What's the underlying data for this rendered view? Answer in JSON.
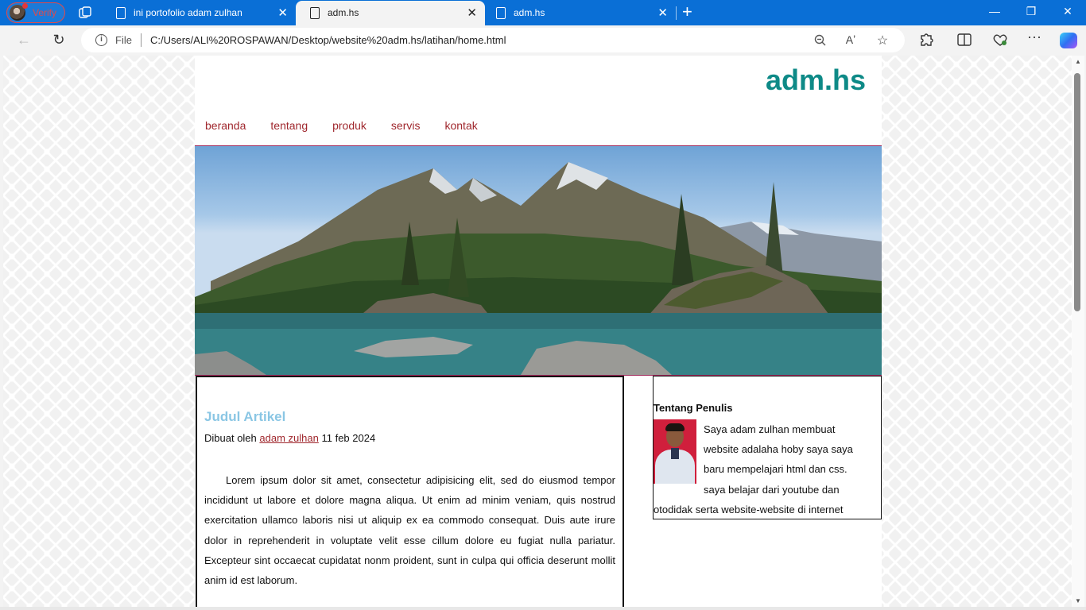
{
  "browser": {
    "profile_label": "Verify",
    "tabs": [
      {
        "title": "ini portofolio adam zulhan",
        "close": "✕"
      },
      {
        "title": "adm.hs",
        "close": "✕"
      },
      {
        "title": "adm.hs",
        "close": "✕"
      }
    ],
    "new_tab": "+",
    "window": {
      "minimize": "—",
      "restore": "❐",
      "close": "✕"
    },
    "address": {
      "scheme_label": "File",
      "url": "C:/Users/ALI%20ROSPAWAN/Desktop/website%20adm.hs/latihan/home.html"
    },
    "icons": {
      "back": "back-icon",
      "refresh": "refresh-icon",
      "zoom": "zoom-icon",
      "read_aloud": "read-aloud-icon",
      "favorite": "star-icon",
      "extensions": "puzzle-icon",
      "split": "split-screen-icon",
      "health": "browser-essentials-icon",
      "menu": "more-icon",
      "copilot": "copilot-icon"
    }
  },
  "page": {
    "site_title": "adm.hs",
    "menu": [
      "beranda",
      "tentang",
      "produk",
      "servis",
      "kontak"
    ],
    "article": {
      "title": "Judul Artikel",
      "meta_prefix": "Dibuat oleh",
      "author": "adam zulhan",
      "date": "11 feb 2024",
      "body": "Lorem ipsum dolor sit amet, consectetur adipisicing elit, sed do eiusmod tempor incididunt ut labore et dolore magna aliqua. Ut enim ad minim veniam, quis nostrud exercitation ullamco laboris nisi ut aliquip ex ea commodo consequat. Duis aute irure dolor in reprehenderit in voluptate velit esse cillum dolore eu fugiat nulla pariatur. Excepteur sint occaecat cupidatat nonm proident, sunt in culpa qui officia deserunt mollit anim id est laborum."
    },
    "aside": {
      "title": "Tentang Penulis",
      "text": "Saya adam zulhan membuat website adalaha hoby saya saya baru mempelajari html dan css. saya belajar dari youtube dan otodidak serta website-website di internet"
    },
    "colors": {
      "site_title": "#0e8a87",
      "menu_link": "#a0282e",
      "article_title": "#8ac6e4",
      "divider": "#a0285a",
      "browser_chrome": "#0a6fd6"
    }
  }
}
